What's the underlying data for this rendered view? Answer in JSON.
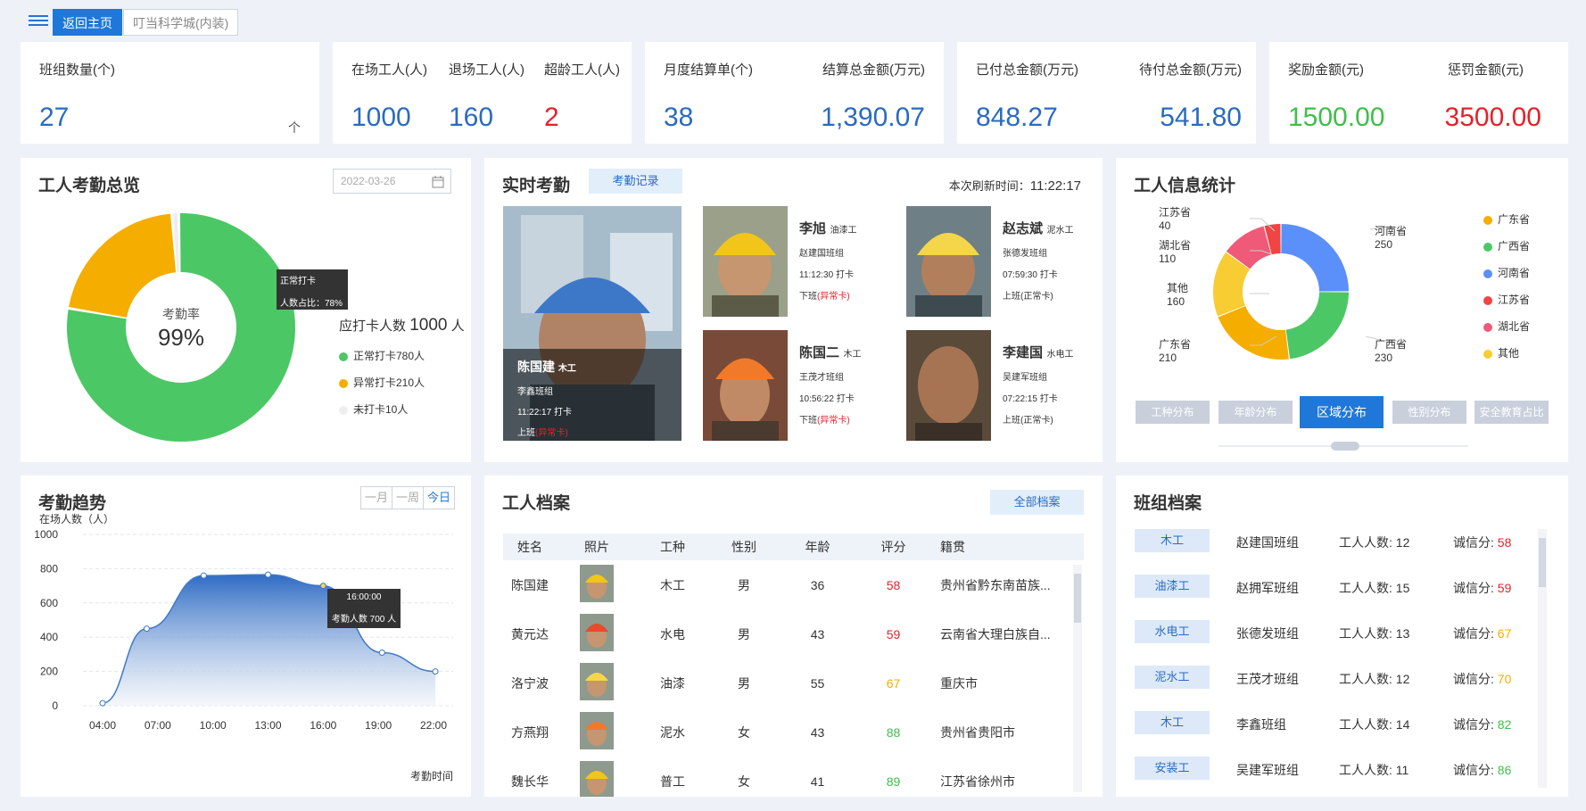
{
  "nav": {
    "back_home": "返回主页",
    "project": "叮当科学城(内装)"
  },
  "stats": {
    "team_count": {
      "label": "班组数量(个)",
      "value": "27",
      "arrow": "个"
    },
    "onsite": {
      "label": "在场工人(人)",
      "value": "1000"
    },
    "left": {
      "label": "退场工人(人)",
      "value": "160"
    },
    "overage": {
      "label": "超龄工人(人)",
      "value": "2"
    },
    "monthly": {
      "label": "月度结算单(个)",
      "value": "38"
    },
    "settle_total": {
      "label": "结算总金额(万元)",
      "value": "1,390.07"
    },
    "paid": {
      "label": "已付总金额(万元)",
      "value": "848.27"
    },
    "unpaid": {
      "label": "待付总金额(万元)",
      "value": "541.80"
    },
    "reward": {
      "label": "奖励金额(元)",
      "value": "1500.00"
    },
    "penalty": {
      "label": "惩罚金额(元)",
      "value": "3500.00"
    }
  },
  "attendance_overview": {
    "title": "工人考勤总览",
    "date_placeholder": "2022-03-26",
    "center_label": "考勤率",
    "center_value": "99%",
    "tooltip_title": "正常打卡",
    "tooltip_value": "人数占比：78%",
    "total_prefix": "应打卡人数",
    "total_value": "1000",
    "total_unit": "人",
    "legend": [
      {
        "label": "正常打卡780人",
        "color": "#4cc765"
      },
      {
        "label": "异常打卡210人",
        "color": "#f5ad00"
      },
      {
        "label": "未打卡10人",
        "color": "#eeeeee"
      }
    ],
    "chart_data": {
      "type": "pie",
      "categories": [
        "正常打卡",
        "异常打卡",
        "未打卡"
      ],
      "values": [
        780,
        210,
        10
      ]
    }
  },
  "realtime": {
    "title": "实时考勤",
    "record_btn": "考勤记录",
    "refresh_label": "本次刷新时间：",
    "refresh_time": "11:22:17",
    "featured": {
      "name": "陈国建",
      "trade": "木工",
      "team": "李鑫班组",
      "time": "11:22:17 打卡",
      "status_prefix": "上班",
      "status": "(异常卡)"
    },
    "workers": [
      {
        "name": "李旭",
        "trade": "油漆工",
        "team": "赵建国班组",
        "time": "11:12:30 打卡",
        "status_prefix": "下班",
        "status": "(异常卡)",
        "abnormal": true
      },
      {
        "name": "赵志斌",
        "trade": "泥水工",
        "team": "张德发班组",
        "time": "07:59:30 打卡",
        "status_prefix": "上班",
        "status": "(正常卡)",
        "abnormal": false
      },
      {
        "name": "陈国二",
        "trade": "木工",
        "team": "王茂才班组",
        "time": "10:56:22 打卡",
        "status_prefix": "下班",
        "status": "(异常卡)",
        "abnormal": true
      },
      {
        "name": "李建国",
        "trade": "水电工",
        "team": "吴建军班组",
        "time": "07:22:15 打卡",
        "status_prefix": "上班",
        "status": "(正常卡)",
        "abnormal": false
      }
    ]
  },
  "worker_stats": {
    "title": "工人信息统计",
    "tabs": [
      "工种分布",
      "年龄分布",
      "区域分布",
      "性别分布",
      "安全教育占比"
    ],
    "active_tab": 2,
    "chart_data": {
      "type": "pie",
      "categories": [
        "广东省",
        "广西省",
        "河南省",
        "江苏省",
        "湖北省",
        "其他"
      ],
      "values": [
        210,
        230,
        250,
        40,
        110,
        160
      ],
      "colors": [
        "#f5ad00",
        "#4cc765",
        "#5b8ff9",
        "#f04545",
        "#ee5a78",
        "#f7cd33"
      ]
    },
    "labels": [
      {
        "name": "江苏省",
        "value": "40"
      },
      {
        "name": "湖北省",
        "value": "110"
      },
      {
        "name": "其他",
        "value": "160"
      },
      {
        "name": "广东省",
        "value": "210"
      },
      {
        "name": "河南省",
        "value": "250"
      },
      {
        "name": "广西省",
        "value": "230"
      }
    ]
  },
  "trend": {
    "title": "考勤趋势",
    "ylabel": "在场人数（人）",
    "xlabel": "考勤时间",
    "range_tabs": [
      "一月",
      "一周",
      "今日"
    ],
    "tooltip_time": "16:00:00",
    "tooltip_value": "考勤人数 700 人",
    "chart_data": {
      "type": "area",
      "x": [
        "04:00",
        "07:00",
        "10:00",
        "13:00",
        "16:00",
        "19:00",
        "22:00"
      ],
      "points": [
        [
          4,
          15
        ],
        [
          6.4,
          450
        ],
        [
          9.5,
          760
        ],
        [
          13,
          765
        ],
        [
          16,
          700
        ],
        [
          19.2,
          310
        ],
        [
          22.1,
          200
        ]
      ],
      "yticks": [
        0,
        200,
        400,
        600,
        800,
        1000
      ],
      "ylim": [
        0,
        1000
      ]
    }
  },
  "archive": {
    "title": "工人档案",
    "all_btn": "全部档案",
    "columns": [
      "姓名",
      "照片",
      "工种",
      "性别",
      "年龄",
      "评分",
      "籍贯"
    ],
    "rows": [
      {
        "name": "陈国建",
        "trade": "木工",
        "gender": "男",
        "age": "36",
        "score": "58",
        "origin": "贵州省黔东南苗族...",
        "score_color": "#e3222b"
      },
      {
        "name": "黄元达",
        "trade": "水电",
        "gender": "男",
        "age": "43",
        "score": "59",
        "origin": "云南省大理白族自...",
        "score_color": "#e3222b"
      },
      {
        "name": "洛宁波",
        "trade": "油漆",
        "gender": "男",
        "age": "55",
        "score": "67",
        "origin": "重庆市",
        "score_color": "#f5ad00"
      },
      {
        "name": "方燕翔",
        "trade": "泥水",
        "gender": "女",
        "age": "43",
        "score": "88",
        "origin": "贵州省贵阳市",
        "score_color": "#3fbf4a"
      },
      {
        "name": "魏长华",
        "trade": "普工",
        "gender": "女",
        "age": "41",
        "score": "89",
        "origin": "江苏省徐州市",
        "score_color": "#3fbf4a"
      }
    ]
  },
  "teams": {
    "title": "班组档案",
    "count_label": "工人人数:",
    "score_label": "诚信分:",
    "rows": [
      {
        "tag": "木工",
        "team": "赵建国班组",
        "count": "12",
        "score": "58",
        "score_color": "#e3222b"
      },
      {
        "tag": "油漆工",
        "team": "赵拥军班组",
        "count": "15",
        "score": "59",
        "score_color": "#e3222b"
      },
      {
        "tag": "水电工",
        "team": "张德发班组",
        "count": "13",
        "score": "67",
        "score_color": "#f5ad00"
      },
      {
        "tag": "泥水工",
        "team": "王茂才班组",
        "count": "12",
        "score": "70",
        "score_color": "#f5ad00"
      },
      {
        "tag": "木工",
        "team": "李鑫班组",
        "count": "14",
        "score": "82",
        "score_color": "#3fbf4a"
      },
      {
        "tag": "安装工",
        "team": "吴建军班组",
        "count": "11",
        "score": "86",
        "score_color": "#3fbf4a"
      }
    ]
  },
  "colors": {
    "accent": "#1f78d9",
    "red": "#e3222b",
    "green": "#3fbf4a",
    "orange": "#f5ad00"
  }
}
